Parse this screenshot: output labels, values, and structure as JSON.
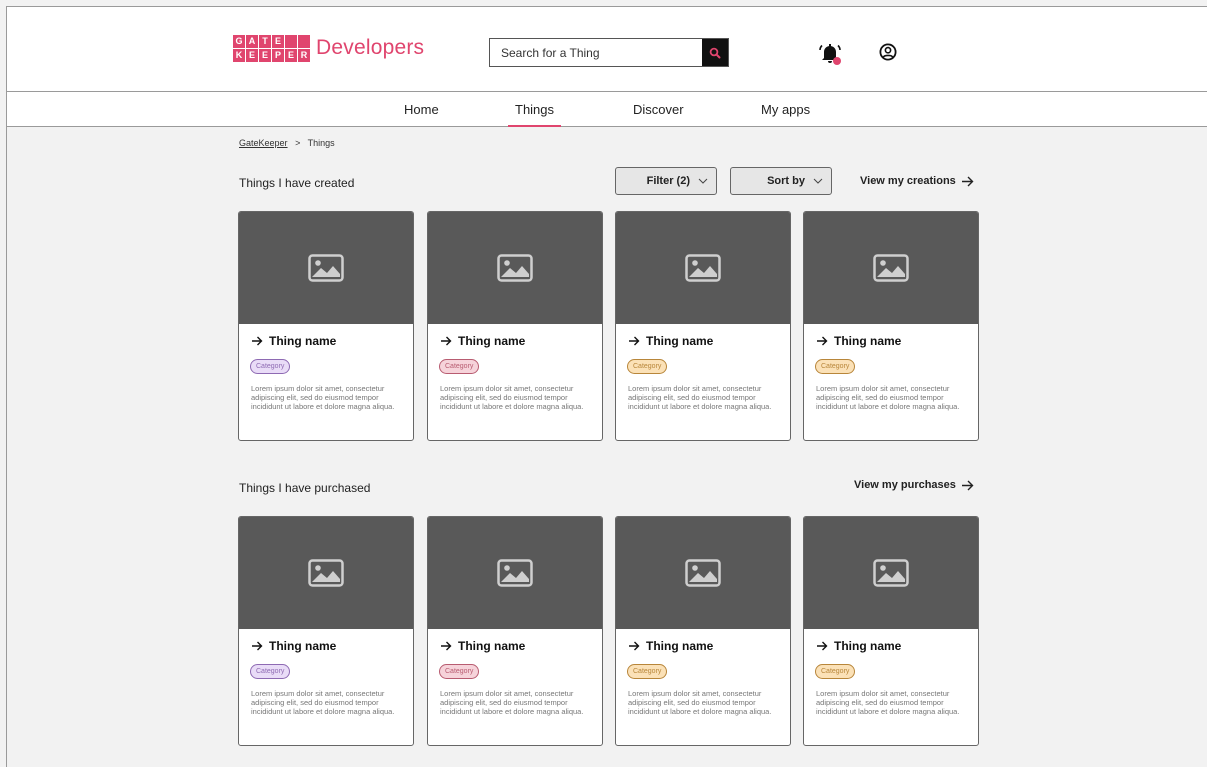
{
  "header": {
    "logo_letters_top": [
      "G",
      "A",
      "T",
      "E",
      "",
      ""
    ],
    "logo_letters_bottom": [
      "K",
      "E",
      "E",
      "P",
      "E",
      "R"
    ],
    "brand": "Developers",
    "search_placeholder": "Search for a Thing",
    "search_icon": "search-icon",
    "notification_icon": "bell-icon",
    "user_icon": "user-circle-icon",
    "accent_color": "#e0456e"
  },
  "nav": {
    "items": [
      {
        "label": "Home"
      },
      {
        "label": "Things"
      },
      {
        "label": "Discover"
      },
      {
        "label": "My apps"
      }
    ],
    "active": "Things"
  },
  "breadcrumb": {
    "root": "GateKeeper",
    "separator": ">",
    "current": "Things"
  },
  "created": {
    "title": "Things I have created",
    "filter_label": "Filter (2)",
    "sort_label": "Sort by",
    "view_link": "View my creations",
    "cards": [
      {
        "name": "Thing name",
        "category": "Category",
        "color": "purple",
        "desc": "Lorem ipsum dolor sit amet, consectetur adipiscing elit, sed do eiusmod tempor incididunt ut labore et dolore magna aliqua."
      },
      {
        "name": "Thing name",
        "category": "Category",
        "color": "pink",
        "desc": "Lorem ipsum dolor sit amet, consectetur adipiscing elit, sed do eiusmod tempor incididunt ut labore et dolore magna aliqua."
      },
      {
        "name": "Thing name",
        "category": "Category",
        "color": "orange",
        "desc": "Lorem ipsum dolor sit amet, consectetur adipiscing elit, sed do eiusmod tempor incididunt ut labore et dolore magna aliqua."
      },
      {
        "name": "Thing name",
        "category": "Category",
        "color": "orange",
        "desc": "Lorem ipsum dolor sit amet, consectetur adipiscing elit, sed do eiusmod tempor incididunt ut labore et dolore magna aliqua."
      }
    ]
  },
  "purchased": {
    "title": "Things I have purchased",
    "view_link": "View my purchases",
    "cards": [
      {
        "name": "Thing name",
        "category": "Category",
        "color": "purple",
        "desc": "Lorem ipsum dolor sit amet, consectetur adipiscing elit, sed do eiusmod tempor incididunt ut labore et dolore magna aliqua."
      },
      {
        "name": "Thing name",
        "category": "Category",
        "color": "pink",
        "desc": "Lorem ipsum dolor sit amet, consectetur adipiscing elit, sed do eiusmod tempor incididunt ut labore et dolore magna aliqua."
      },
      {
        "name": "Thing name",
        "category": "Category",
        "color": "orange",
        "desc": "Lorem ipsum dolor sit amet, consectetur adipiscing elit, sed do eiusmod tempor incididunt ut labore et dolore magna aliqua."
      },
      {
        "name": "Thing name",
        "category": "Category",
        "color": "orange",
        "desc": "Lorem ipsum dolor sit amet, consectetur adipiscing elit, sed do eiusmod tempor incididunt ut labore et dolore magna aliqua."
      }
    ]
  }
}
